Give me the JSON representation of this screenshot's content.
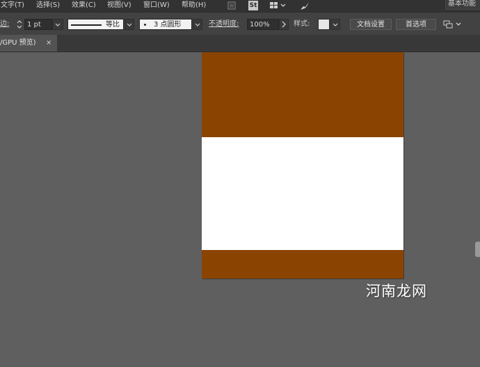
{
  "menu": {
    "items": [
      "文字(T)",
      "选择(S)",
      "效果(C)",
      "视图(V)",
      "窗口(W)",
      "帮助(H)"
    ],
    "workspace": "基本功能"
  },
  "controls": {
    "stroke_label": "边:",
    "stroke_value": "1 pt",
    "line_label": "等比",
    "brush_label": "3 点圆形",
    "opacity_label": "不透明度:",
    "opacity_value": "100%",
    "style_label": "样式:",
    "doc_setup_button": "文档设置",
    "prefs_button": "首选项"
  },
  "tab": {
    "title": "/GPU 预览)",
    "close": "×"
  },
  "icons": {
    "stock": "St",
    "arrange": "arrange-icon",
    "brush": "brush-icon"
  },
  "colors": {
    "band": "#8a4300",
    "artboard": "#ffffff",
    "canvas": "#5f5f5f"
  },
  "watermark": "河南龙网"
}
